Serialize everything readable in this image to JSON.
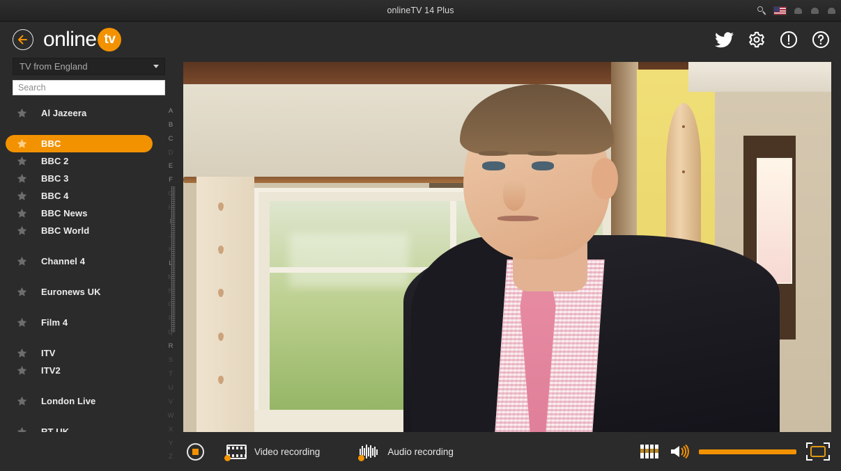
{
  "window": {
    "title": "onlineTV 14 Plus",
    "search_icon": "search-icon",
    "flag_icon": "us-flag-icon",
    "controls": [
      "minimize-button",
      "maximize-button",
      "close-button"
    ]
  },
  "header": {
    "back_icon": "back-arrow-icon",
    "logo_word": "online",
    "logo_badge": "tv",
    "icons": [
      {
        "name": "twitter-icon",
        "label": "Twitter"
      },
      {
        "name": "gear-icon",
        "label": "Settings"
      },
      {
        "name": "info-icon",
        "label": "Info"
      },
      {
        "name": "help-icon",
        "label": "Help"
      }
    ]
  },
  "sidebar": {
    "region_select": {
      "value": "TV from England",
      "caret_icon": "chevron-down-icon"
    },
    "search": {
      "value": "",
      "placeholder": "Search"
    },
    "channels": [
      {
        "name": "Al Jazeera",
        "favorite": false,
        "selected": false,
        "group_start": true
      },
      {
        "name": "BBC",
        "favorite": true,
        "selected": true,
        "group_start": true
      },
      {
        "name": "BBC 2",
        "favorite": false,
        "selected": false,
        "group_start": false
      },
      {
        "name": "BBC 3",
        "favorite": false,
        "selected": false,
        "group_start": false
      },
      {
        "name": "BBC 4",
        "favorite": false,
        "selected": false,
        "group_start": false
      },
      {
        "name": "BBC News",
        "favorite": false,
        "selected": false,
        "group_start": false
      },
      {
        "name": "BBC World",
        "favorite": false,
        "selected": false,
        "group_start": false
      },
      {
        "name": "Channel 4",
        "favorite": false,
        "selected": false,
        "group_start": true
      },
      {
        "name": "Euronews UK",
        "favorite": false,
        "selected": false,
        "group_start": true
      },
      {
        "name": "Film 4",
        "favorite": false,
        "selected": false,
        "group_start": true
      },
      {
        "name": "ITV",
        "favorite": false,
        "selected": false,
        "group_start": true
      },
      {
        "name": "ITV2",
        "favorite": false,
        "selected": false,
        "group_start": false
      },
      {
        "name": "London Live",
        "favorite": false,
        "selected": false,
        "group_start": true
      },
      {
        "name": "RT UK",
        "favorite": false,
        "selected": false,
        "group_start": true
      }
    ],
    "alphabet_index": [
      {
        "letter": "A",
        "active": true
      },
      {
        "letter": "B",
        "active": true
      },
      {
        "letter": "C",
        "active": true
      },
      {
        "letter": "D",
        "active": false
      },
      {
        "letter": "E",
        "active": true
      },
      {
        "letter": "F",
        "active": true
      },
      {
        "letter": "G",
        "active": false
      },
      {
        "letter": "H",
        "active": false
      },
      {
        "letter": "I",
        "active": true
      },
      {
        "letter": "J",
        "active": false
      },
      {
        "letter": "K",
        "active": false
      },
      {
        "letter": "L",
        "active": true
      },
      {
        "letter": "M",
        "active": false
      },
      {
        "letter": "N",
        "active": false
      },
      {
        "letter": "O",
        "active": false
      },
      {
        "letter": "P",
        "active": false
      },
      {
        "letter": "Q",
        "active": false
      },
      {
        "letter": "R",
        "active": true
      },
      {
        "letter": "S",
        "active": false
      },
      {
        "letter": "T",
        "active": false
      },
      {
        "letter": "U",
        "active": false
      },
      {
        "letter": "V",
        "active": false
      },
      {
        "letter": "W",
        "active": false
      },
      {
        "letter": "X",
        "active": false
      },
      {
        "letter": "Y",
        "active": false
      },
      {
        "letter": "Z",
        "active": false
      }
    ]
  },
  "player": {
    "scene_description": "Man in dark suit with pink tie standing in a living room with a window"
  },
  "bottombar": {
    "record_button": "record-button",
    "video_recording_label": "Video recording",
    "audio_recording_label": "Audio recording",
    "equalizer_icon": "equalizer-icon",
    "speaker_icon": "speaker-icon",
    "volume_percent": 100,
    "fullscreen_icon": "fullscreen-icon"
  },
  "colors": {
    "accent": "#f39200",
    "background": "#2b2b2b",
    "titlebar": "#262626",
    "text": "#ececec"
  }
}
